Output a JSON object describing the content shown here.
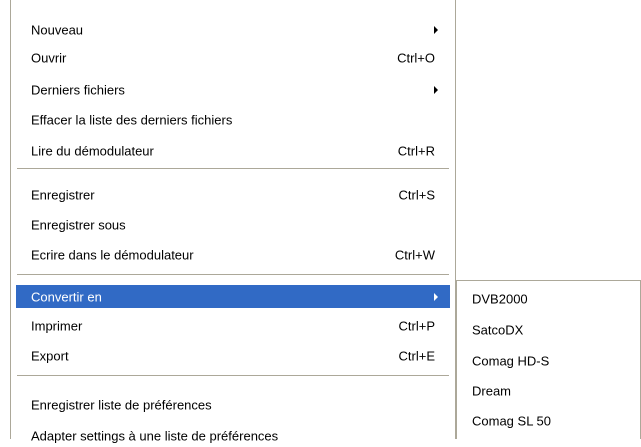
{
  "file_menu": {
    "items": [
      {
        "label": "Nouveau",
        "shortcut": "",
        "submenu": true
      },
      {
        "label": "Ouvrir",
        "shortcut": "Ctrl+O"
      },
      {
        "label": "Derniers fichiers",
        "shortcut": "",
        "submenu": true
      },
      {
        "label": "Effacer la liste des derniers fichiers",
        "shortcut": ""
      },
      {
        "label": "Lire du démodulateur",
        "shortcut": "Ctrl+R"
      },
      {
        "label": "Enregistrer",
        "shortcut": "Ctrl+S"
      },
      {
        "label": "Enregistrer sous",
        "shortcut": ""
      },
      {
        "label": "Ecrire dans le démodulateur",
        "shortcut": "Ctrl+W"
      },
      {
        "label": "Convertir en",
        "shortcut": "",
        "submenu": true,
        "highlighted": true
      },
      {
        "label": "Imprimer",
        "shortcut": "Ctrl+P"
      },
      {
        "label": "Export",
        "shortcut": "Ctrl+E"
      },
      {
        "label": "Enregistrer liste de préférences",
        "shortcut": ""
      },
      {
        "label": "Adapter settings à une liste de préférences",
        "shortcut": ""
      }
    ]
  },
  "convert_submenu": {
    "items": [
      {
        "label": "DVB2000"
      },
      {
        "label": "SatcoDX"
      },
      {
        "label": "Comag HD-S"
      },
      {
        "label": "Dream"
      },
      {
        "label": "Comag SL 50"
      }
    ]
  },
  "colors": {
    "highlight_bg": "#316ac5",
    "highlight_text": "#ffffff",
    "separator": "#aca899",
    "menu_bg": "#ffffff"
  }
}
